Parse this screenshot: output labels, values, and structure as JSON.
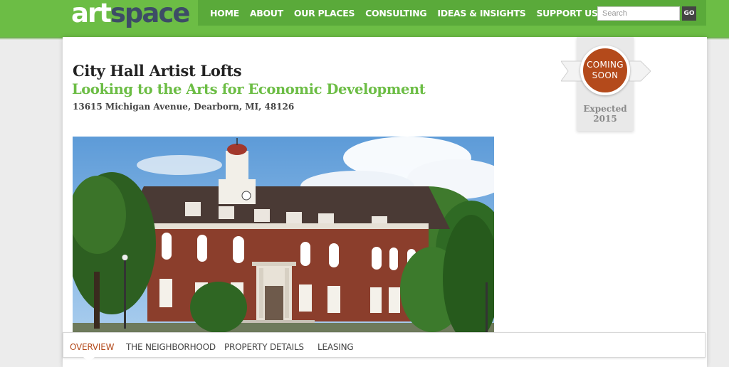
{
  "logo": {
    "part1": "art",
    "part2": "space"
  },
  "nav": {
    "items": [
      "HOME",
      "ABOUT",
      "OUR PLACES",
      "CONSULTING",
      "IDEAS & INSIGHTS",
      "SUPPORT US"
    ]
  },
  "search": {
    "placeholder": "Search",
    "go_label": "GO"
  },
  "project": {
    "title": "City Hall Artist Lofts",
    "subtitle": "Looking to the Arts for Economic Development",
    "address": "13615 Michigan Avenue, Dearborn, MI, 48126"
  },
  "badge": {
    "line1": "COMING",
    "line2": "SOON",
    "expected_label": "Expected",
    "expected_year": "2015",
    "color": "#b44a1b"
  },
  "tabs": {
    "items": [
      "OVERVIEW",
      "THE NEIGHBORHOOD",
      "PROPERTY DETAILS",
      "LEASING"
    ],
    "active": "OVERVIEW"
  },
  "colors": {
    "brand_green": "#6cbd45",
    "accent": "#b44a1b",
    "logo_dark": "#3d4c66"
  }
}
